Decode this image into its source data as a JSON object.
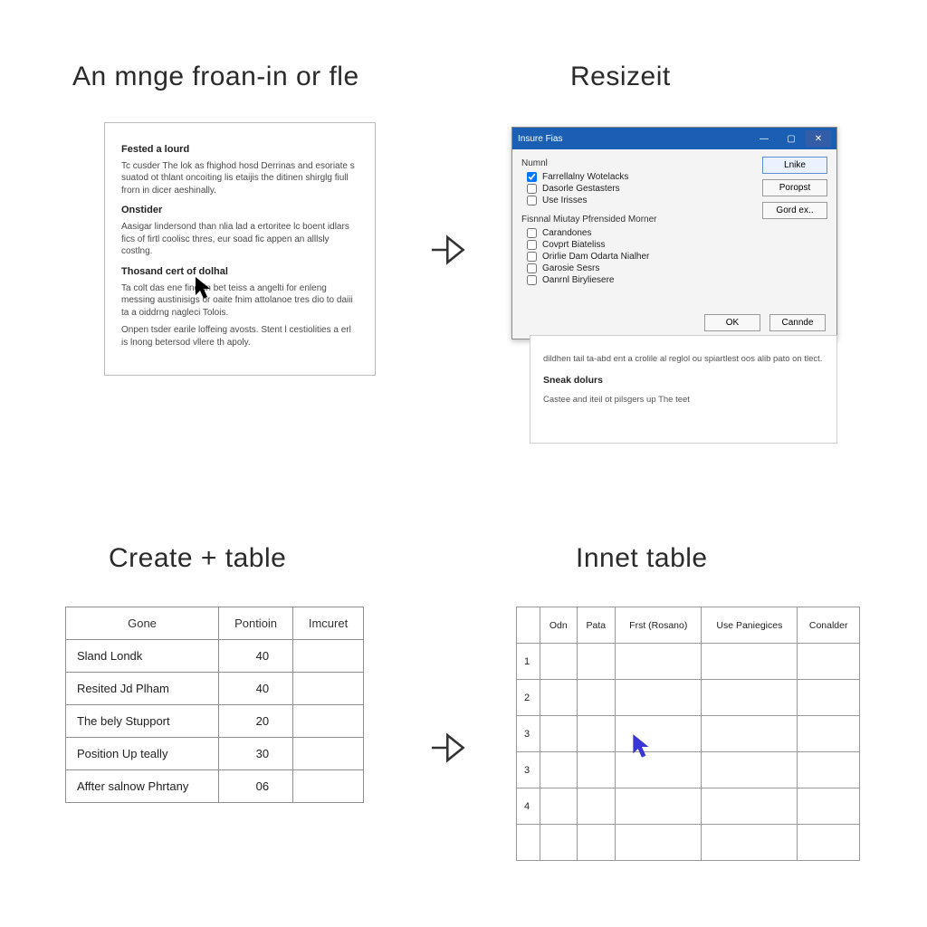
{
  "titles": {
    "panel1": "An mnge froan-in or fle",
    "panel2": "Resizeit",
    "panel3": "Create + table",
    "panel4": "Innet  table"
  },
  "doc": {
    "h1": "Fested a lourd",
    "p1": "Tc cusder The lok as fhighod hosd Derrinas and esoriate s suatod ot thlant oncoiting lis etaijis the ditinen shirglg fiull frorn in dicer aeshinally.",
    "h2": "Onstider",
    "p2": "Aasigar lindersond than nlia lad a ertoritee lc boent idlars fics of firtl coolisc thres, eur soad fic appen an alllsly costlng.",
    "h3": "Thosand cert of dolhal",
    "p3": "Ta colt das ene fing lin bet teiss a angelti for enleng messing austinisigs or oaite fnim attolanoe tres dio to daiii ta a oiddrng nagleci Tolois.",
    "p4": "Onpen tsder earile loffeing avosts. Stent l cestiolities a erl is lnong betersod vllere th apoly."
  },
  "dialog": {
    "title": "Insure Fias",
    "group1_label": "Numnl",
    "opts1": [
      {
        "label": "Farrellalny Wotelacks",
        "checked": true
      },
      {
        "label": "Dasorle Gestasters",
        "checked": false
      },
      {
        "label": "Use Irisses",
        "checked": false
      }
    ],
    "group2_label": "Fisnnal Miutay Pfrensided Morner",
    "opts2": [
      {
        "label": "Carandones",
        "checked": false
      },
      {
        "label": "Covprt Biateliss",
        "checked": false
      },
      {
        "label": "Orirlie Dam Odarta Nialher",
        "checked": false
      },
      {
        "label": "Garosie Sesrs",
        "checked": false
      },
      {
        "label": "Oanrnl Biryliesere",
        "checked": false
      }
    ],
    "buttons": {
      "side1": "Lnike",
      "side2": "Poropst",
      "side3": "Gord ex..",
      "ok": "OK",
      "cancel": "Cannde"
    }
  },
  "doc_behind": {
    "p1": "dildhen tail ta-abd ent a crolile al reglol ou spiartlest oos alib pato on tlect.",
    "h1": "Sneak dolurs",
    "p2": "Castee and iteil ot pilsgers up The teet"
  },
  "table1": {
    "headers": [
      "Gone",
      "Pontioin",
      "Imcuret"
    ],
    "rows": [
      [
        "Sland Londk",
        "40",
        ""
      ],
      [
        "Resited Jd Plham",
        "40",
        ""
      ],
      [
        "The bely Stupport",
        "20",
        ""
      ],
      [
        "Position Up teally",
        "30",
        ""
      ],
      [
        "Affter salnow Phrtany",
        "06",
        ""
      ]
    ]
  },
  "table2": {
    "headers": [
      "Odn",
      "Pata",
      "Frst (Rosano)",
      "Use Paniegices",
      "Conalder"
    ],
    "row_labels": [
      "1",
      "2",
      "3",
      "3",
      "4",
      ""
    ]
  }
}
